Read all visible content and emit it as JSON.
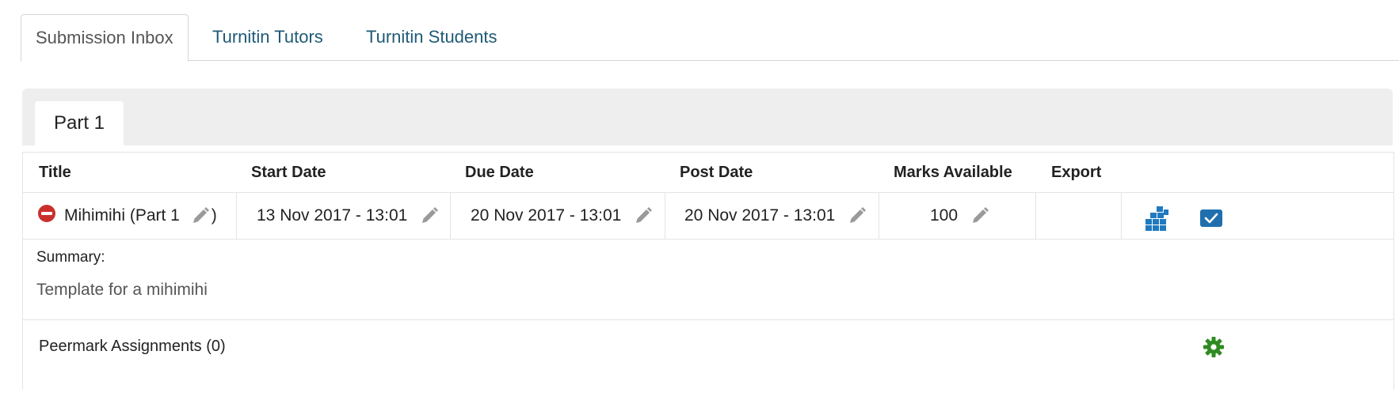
{
  "tabs": {
    "submission_inbox": "Submission Inbox",
    "turnitin_tutors": "Turnitin Tutors",
    "turnitin_students": "Turnitin Students"
  },
  "part_tab": "Part 1",
  "table": {
    "headers": {
      "title": "Title",
      "start_date": "Start Date",
      "due_date": "Due Date",
      "post_date": "Post Date",
      "marks_available": "Marks Available",
      "export": "Export"
    },
    "row": {
      "title_prefix": "Mihimihi (Part 1",
      "title_suffix": ")",
      "start_date": "13 Nov 2017 - 13:01",
      "due_date": "20 Nov 2017 - 13:01",
      "post_date": "20 Nov 2017 - 13:01",
      "marks": "100"
    }
  },
  "summary": {
    "label": "Summary:",
    "text": "Template for a mihimihi"
  },
  "peermark": {
    "label": "Peermark Assignments (0)"
  },
  "icons": {
    "delete": "minus-circle-icon",
    "edit": "pencil-icon",
    "export": "grid-blocks-icon",
    "check": "checkbox-checked-icon",
    "settings": "gear-icon"
  },
  "colors": {
    "tab_link": "#1f5a76",
    "delete_red": "#c9302c",
    "export_blue": "#1f7ac0",
    "settings_green": "#2e8b21"
  }
}
